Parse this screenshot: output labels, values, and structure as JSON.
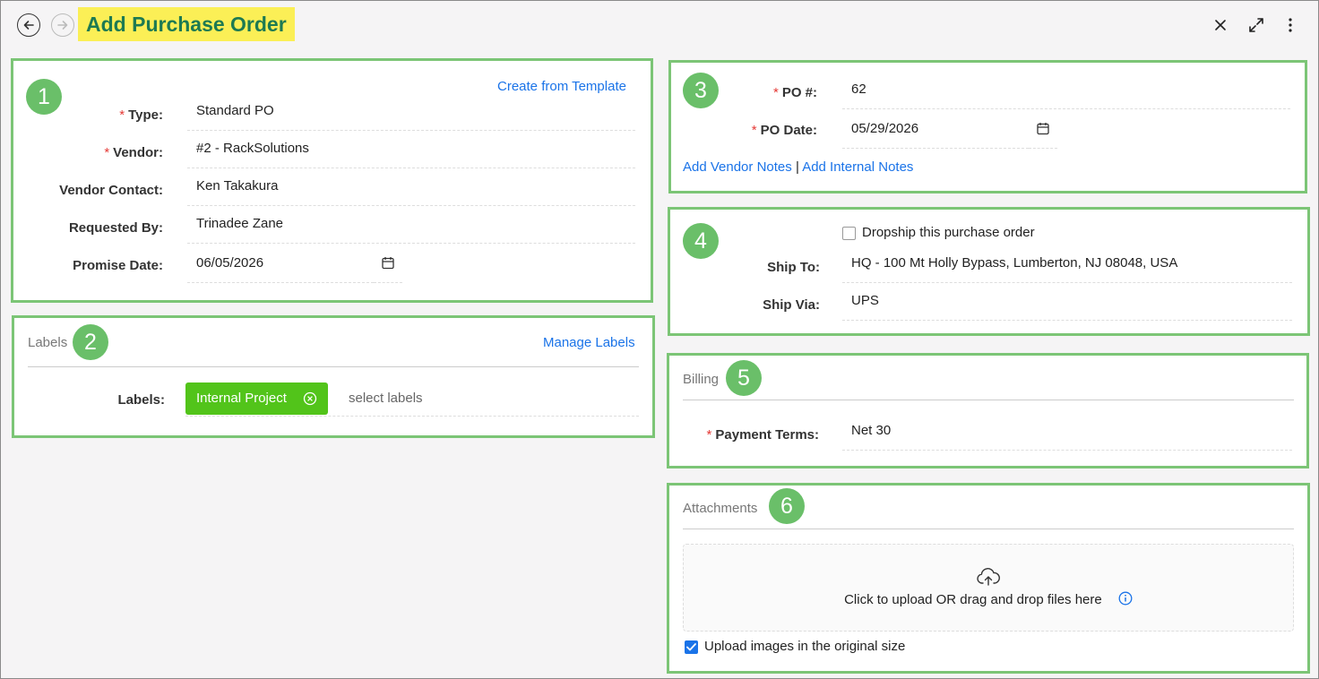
{
  "header": {
    "title": "Add Purchase Order"
  },
  "panel1": {
    "step": "1",
    "template_link": "Create from Template",
    "type_label": "Type:",
    "type_value": "Standard PO",
    "vendor_label": "Vendor:",
    "vendor_value": "#2 - RackSolutions",
    "vendor_contact_label": "Vendor Contact:",
    "vendor_contact_value": "Ken Takakura",
    "requested_by_label": "Requested By:",
    "requested_by_value": "Trinadee Zane",
    "promise_date_label": "Promise Date:",
    "promise_date_value": "06/05/2026"
  },
  "panel2": {
    "step": "2",
    "title": "Labels",
    "manage_link": "Manage Labels",
    "labels_label": "Labels:",
    "chip": "Internal Project",
    "placeholder": "select labels"
  },
  "panel3": {
    "step": "3",
    "po_num_label": "PO #:",
    "po_num_value": "62",
    "po_date_label": "PO Date:",
    "po_date_value": "05/29/2026",
    "vendor_notes_link": "Add Vendor Notes",
    "separator": "|",
    "internal_notes_link": "Add Internal Notes"
  },
  "panel4": {
    "step": "4",
    "dropship_label": "Dropship this purchase order",
    "dropship_checked": false,
    "ship_to_label": "Ship To:",
    "ship_to_value": "HQ - 100 Mt Holly Bypass, Lumberton, NJ 08048, USA",
    "ship_via_label": "Ship Via:",
    "ship_via_value": "UPS"
  },
  "panel5": {
    "step": "5",
    "title": "Billing",
    "payment_terms_label": "Payment Terms:",
    "payment_terms_value": "Net 30"
  },
  "panel6": {
    "step": "6",
    "title": "Attachments",
    "upload_text": "Click to upload OR drag and drop files here",
    "original_size_label": "Upload images in the original size",
    "original_size_checked": true
  },
  "colors": {
    "accent": "#1a73e8",
    "panel_border": "#7cc576",
    "step_badge": "#6abf69",
    "title_highlight": "#fbef56",
    "title_text": "#1d7a52",
    "chip": "#52c41a",
    "required": "#e53935"
  }
}
